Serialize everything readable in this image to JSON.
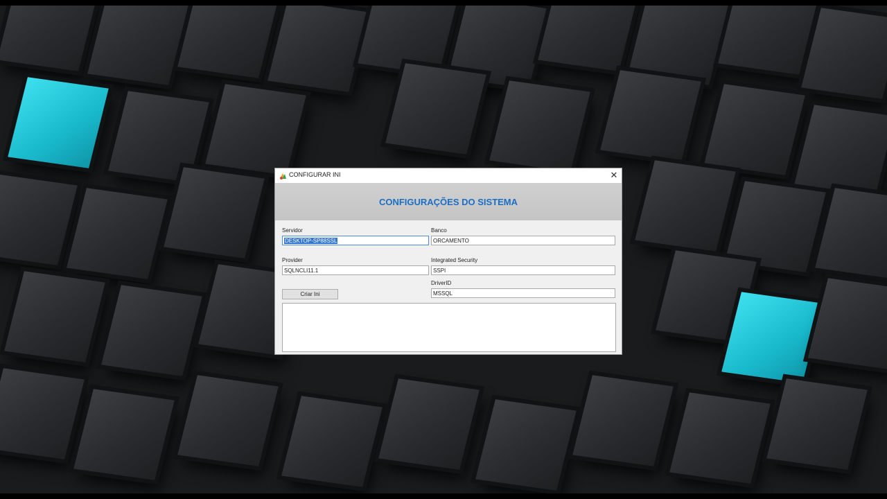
{
  "window": {
    "title": "CONFIGURAR INI",
    "close_glyph": "✕"
  },
  "banner": {
    "title": "CONFIGURAÇÕES DO SISTEMA"
  },
  "fields": {
    "servidor": {
      "label": "Servidor",
      "value": "DESKTOP-SP88SSL"
    },
    "banco": {
      "label": "Banco",
      "value": "ORCAMENTO"
    },
    "provider": {
      "label": "Provider",
      "value": "SQLNCLI11.1"
    },
    "integrated_security": {
      "label": "Integrated Security",
      "value": "SSPI"
    },
    "driver_id": {
      "label": "DriverID",
      "value": "MSSQL"
    }
  },
  "buttons": {
    "criar_ini": "Criar Ini"
  },
  "memo": {
    "value": ""
  },
  "colors": {
    "accent": "#1a6fc4",
    "selection": "#3176d1",
    "cyan_tile": "#2bd0e0"
  },
  "icons": {
    "app": "app-icon",
    "close": "close-icon"
  }
}
